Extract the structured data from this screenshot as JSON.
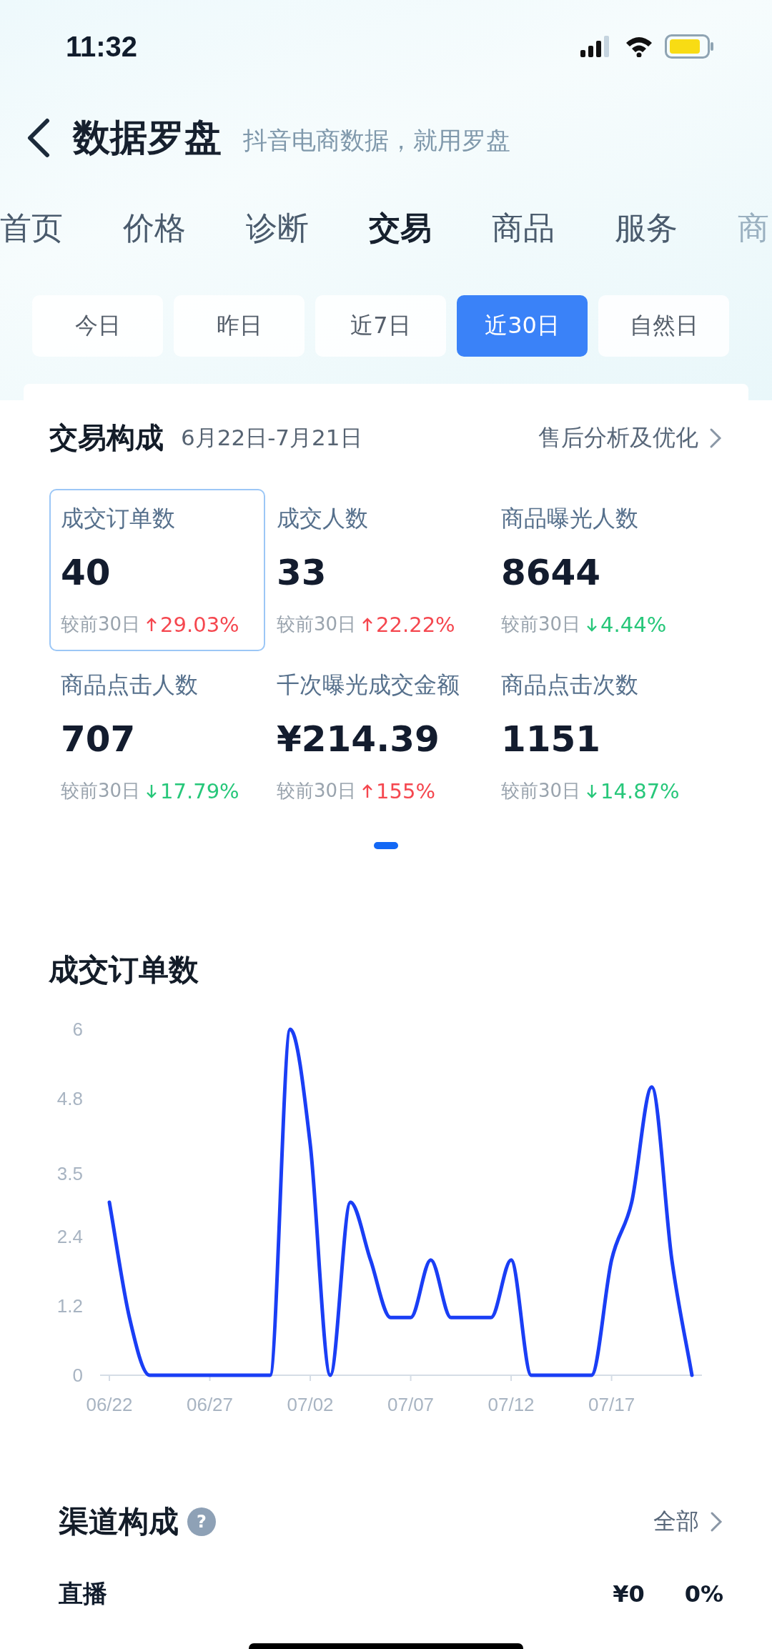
{
  "status_bar": {
    "time": "11:32"
  },
  "header": {
    "title": "数据罗盘",
    "subtitle": "抖音电商数据，就用罗盘"
  },
  "tabs": [
    {
      "label": "首页",
      "selected": false
    },
    {
      "label": "价格",
      "selected": false
    },
    {
      "label": "诊断",
      "selected": false
    },
    {
      "label": "交易",
      "selected": true
    },
    {
      "label": "商品",
      "selected": false
    },
    {
      "label": "服务",
      "selected": false
    },
    {
      "label": "商",
      "selected": false
    }
  ],
  "date_ranges": [
    {
      "label": "今日",
      "selected": false
    },
    {
      "label": "昨日",
      "selected": false
    },
    {
      "label": "近7日",
      "selected": false
    },
    {
      "label": "近30日",
      "selected": true
    },
    {
      "label": "自然日",
      "selected": false
    }
  ],
  "composition_card": {
    "title": "交易构成",
    "date_range": "6月22日-7月21日",
    "link": "售后分析及优化",
    "metrics": [
      {
        "label": "成交订单数",
        "value": "40",
        "compare": "较前30日",
        "change": "29.03%",
        "increase": true,
        "selected": true
      },
      {
        "label": "成交人数",
        "value": "33",
        "compare": "较前30日",
        "change": "22.22%",
        "increase": true,
        "selected": false
      },
      {
        "label": "商品曝光人数",
        "value": "8644",
        "compare": "较前30日",
        "change": "4.44%",
        "increase": false,
        "selected": false
      },
      {
        "label": "商品点击人数",
        "value": "707",
        "compare": "较前30日",
        "change": "17.79%",
        "increase": false,
        "selected": false
      },
      {
        "label": "千次曝光成交金额",
        "value": "¥214.39",
        "compare": "较前30日",
        "change": "155%",
        "increase": true,
        "selected": false
      },
      {
        "label": "商品点击次数",
        "value": "1151",
        "compare": "较前30日",
        "change": "14.87%",
        "increase": false,
        "selected": false
      }
    ]
  },
  "order_chart": {
    "title": "成交订单数",
    "chart_data": {
      "type": "line",
      "categories": [
        "06/22",
        null,
        null,
        null,
        null,
        "06/27",
        null,
        null,
        null,
        null,
        "07/02",
        null,
        null,
        null,
        null,
        "07/07",
        null,
        null,
        null,
        null,
        "07/12",
        null,
        null,
        null,
        null,
        "07/17",
        null,
        null,
        null,
        null
      ],
      "series": [
        {
          "color": "#1a3ef5",
          "values": [
            3,
            1,
            0,
            0,
            0,
            0,
            0,
            0,
            0,
            6,
            4,
            0,
            3,
            2,
            1,
            1,
            2,
            1,
            1,
            1,
            2,
            0,
            0,
            0,
            0,
            2,
            3,
            5,
            2,
            0
          ]
        }
      ],
      "ylim": [
        0,
        6
      ],
      "yticks": [
        0,
        1.2,
        2.4,
        3.5,
        4.8,
        6
      ]
    }
  },
  "channel_section": {
    "title": "渠道构成",
    "help": "?",
    "filter": "全部",
    "rows": [
      {
        "name": "直播",
        "amount": "¥0",
        "share": "0%"
      }
    ]
  }
}
